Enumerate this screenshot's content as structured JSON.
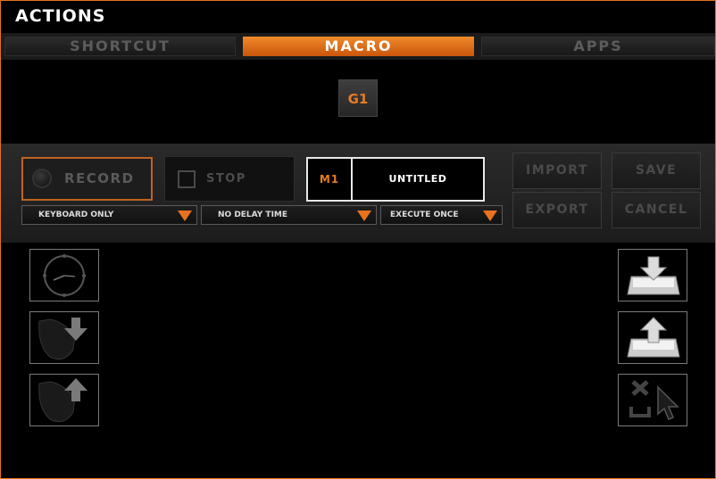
{
  "window": {
    "title": "ACTIONS"
  },
  "tabs": [
    {
      "label": "SHORTCUT",
      "active": false
    },
    {
      "label": "MACRO",
      "active": true
    },
    {
      "label": "APPS",
      "active": false
    }
  ],
  "gkey": {
    "label": "G1"
  },
  "controls": {
    "record_label": "RECORD",
    "stop_label": "STOP",
    "macro_slot": "M1",
    "macro_name": "UNTITLED",
    "import_label": "IMPORT",
    "save_label": "SAVE",
    "export_label": "EXPORT",
    "cancel_label": "CANCEL"
  },
  "dropdowns": {
    "record_mode": "KEYBOARD ONLY",
    "delay": "NO DELAY TIME",
    "execution": "EXECUTE ONCE"
  },
  "colors": {
    "accent": "#e67b22",
    "background": "#000000",
    "panel": "#222222"
  },
  "left_icons": [
    "clock-icon",
    "mouse-down-icon",
    "mouse-up-icon"
  ],
  "right_icons": [
    "key-down-icon",
    "key-up-icon",
    "delete-cursor-icon"
  ]
}
